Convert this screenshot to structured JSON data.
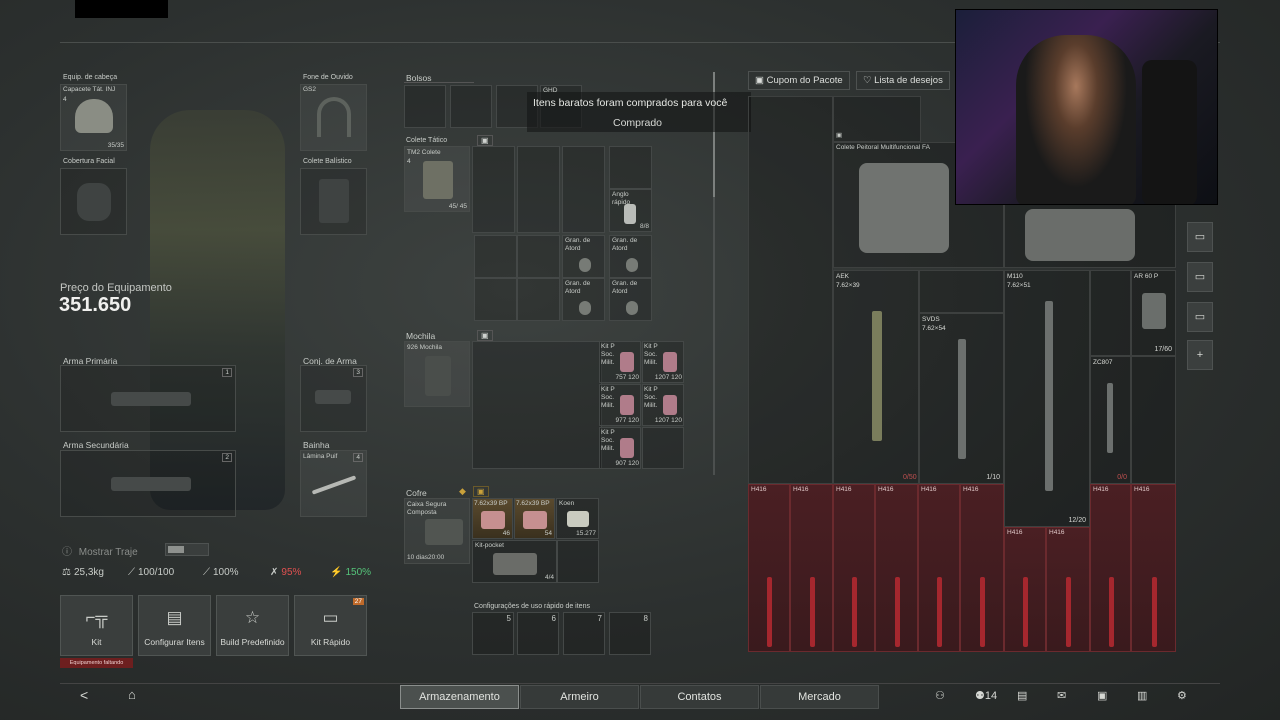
{
  "equipment": {
    "head_label": "Equip. de cabeça",
    "head_item": "Capacete Tát. INJ",
    "head_level": "4",
    "head_durability": "35/35",
    "face_label": "Cobertura Facial",
    "ear_label": "Fone de Ouvido",
    "ear_item": "GS2",
    "vest_label": "Colete Balístico",
    "price_label": "Preço do Equipamento",
    "price_value": "351.650",
    "primary_label": "Arma Primária",
    "primary_num": "1",
    "secondary_label": "Arma Secundária",
    "secondary_num": "2",
    "pistol_label": "Conj. de Arma",
    "pistol_num": "3",
    "melee_label": "Bainha",
    "melee_item": "Lâmina Puif",
    "melee_num": "4",
    "show_outfit": "Mostrar Traje"
  },
  "stats": {
    "weight": "25,3kg",
    "stat2": "100/100",
    "stat3": "100%",
    "stat4": "95%",
    "stat5": "150%"
  },
  "tiles": [
    {
      "label": "Kit",
      "glyph": "⌐╦"
    },
    {
      "label": "Configurar Itens",
      "glyph": "▤"
    },
    {
      "label": "Build Predefinido",
      "glyph": "☆"
    },
    {
      "label": "Kit Rápido",
      "glyph": "▭",
      "badge": "27"
    }
  ],
  "kit_warning": "Equipamento faltando",
  "inventory": {
    "pockets_label": "Bolsos",
    "ghd_label": "GHD",
    "vest_label": "Colete Tático",
    "vest_item": "TM2 Colete",
    "vest_level": "4",
    "vest_durability": "45/ 45",
    "item_anglo": "Anglo rápido",
    "item_anglo_count": "8/8",
    "grenade": "Gran. de Atord",
    "backpack_label": "Mochila",
    "backpack_item": "926 Mochila",
    "kit_item": "Kit P Soc. Milit.",
    "kit_counts": [
      "757 120",
      "1207 120",
      "977 120",
      "1207 120",
      "907 120"
    ],
    "safe_label": "Cofre",
    "safe_item": "Caixa Segura Composta",
    "safe_time": "10 dias20:00",
    "ammo1": "7.62x39 BP",
    "ammo1_count": "46",
    "ammo2": "7.62x39 BP",
    "ammo2_count": "54",
    "koen": "Koen",
    "koen_count": "15.277",
    "kit_pocket": "Kit-pocket",
    "kit_pocket_count": "4/4",
    "quick_label": "Configurações de uso rápido de itens",
    "quick_nums": [
      "5",
      "6",
      "7",
      "8"
    ]
  },
  "toast": {
    "line1": "Itens baratos foram comprados para você",
    "line2": "Comprado"
  },
  "storage": {
    "coupon_btn": "Cupom do Pacote",
    "wishlist_btn": "Lista de desejos",
    "armor_item": "Colete Peitoral Multifuncional FA",
    "weapons": [
      {
        "name": "AEK",
        "cal": "7.62×39"
      },
      {
        "name": "SVDS",
        "cal": "7.62×54"
      },
      {
        "name": "M110",
        "cal": "7.62×51"
      },
      {
        "name": "AR 60 P",
        "cal": ""
      },
      {
        "name": "ZC807",
        "cal": ""
      }
    ],
    "count_50": "0/50",
    "count_10": "1/10",
    "count_20": "12/20",
    "count_60": "17/60",
    "count_0": "0/0",
    "h416": "H416"
  },
  "nav": {
    "tabs": [
      "Armazenamento",
      "Armeiro",
      "Contatos",
      "Mercado"
    ],
    "friends_count": "14"
  },
  "colors": {
    "accent_red": "#e05050",
    "accent_green": "#55c47a",
    "locked_red": "#4a1f23"
  }
}
